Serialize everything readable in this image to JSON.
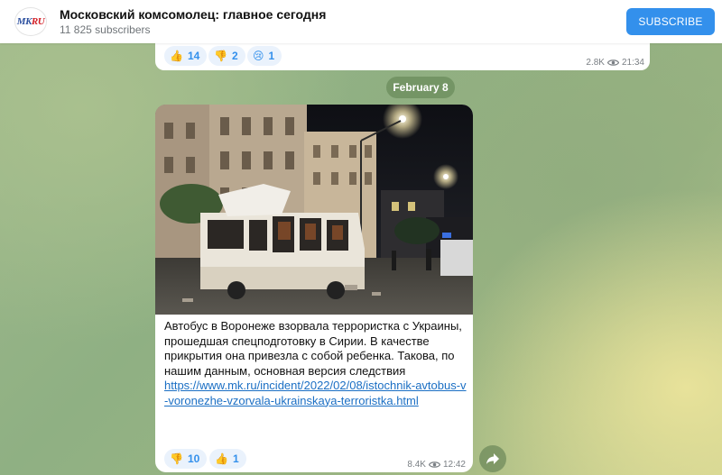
{
  "channel": {
    "logo_text_main": "MK",
    "logo_text_accent": "RU",
    "title": "Московский комсомолец: главное сегодня",
    "subscribers": "11 825 subscribers",
    "subscribe_label": "SUBSCRIBE"
  },
  "previous_message": {
    "reactions": [
      {
        "emoji": "👍",
        "count": "14"
      },
      {
        "emoji": "👎",
        "count": "2"
      },
      {
        "emoji": "😢",
        "count": "1"
      }
    ],
    "views": "2.8K",
    "time": "21:34"
  },
  "date_separator": "February 8",
  "message": {
    "text": "Автобус в Воронеже взорвала террористка с Украины, прошедшая спецподготовку в Сирии. В качестве прикрытия она привезла с собой ребенка. Такова, по нашим данным, основная версия следствия",
    "link": "https://www.mk.ru/incident/2022/02/08/istochnik-avtobus-v-voronezhe-vzorvala-ukrainskaya-terroristka.html",
    "reactions": [
      {
        "emoji": "👎",
        "count": "10"
      },
      {
        "emoji": "👍",
        "count": "1"
      }
    ],
    "views": "8.4K",
    "time": "12:42"
  },
  "colors": {
    "accent": "#3390ec",
    "reaction_bg": "#eaf2fc",
    "link": "#1b6fc4"
  }
}
